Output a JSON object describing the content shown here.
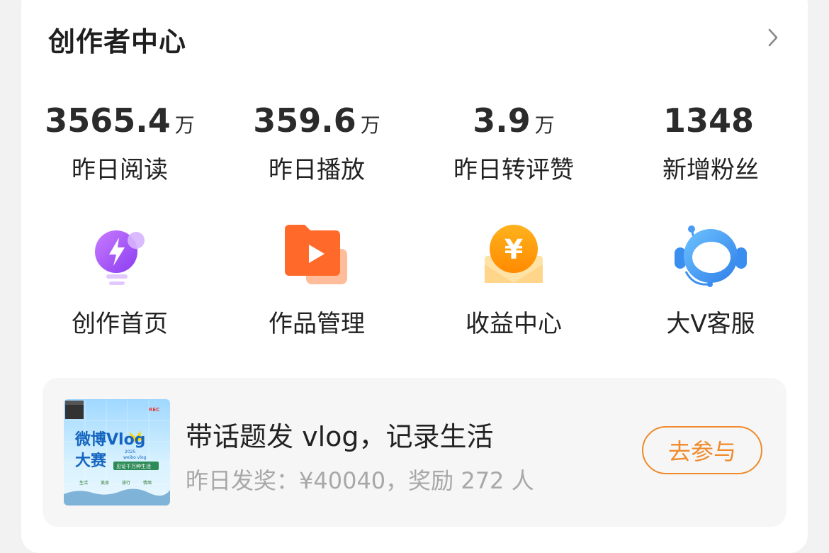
{
  "header": {
    "title": "创作者中心"
  },
  "stats": [
    {
      "value": "3565.4",
      "unit": "万",
      "label": "昨日阅读"
    },
    {
      "value": "359.6",
      "unit": "万",
      "label": "昨日播放"
    },
    {
      "value": "3.9",
      "unit": "万",
      "label": "昨日转评赞"
    },
    {
      "value": "1348",
      "unit": "",
      "label": "新增粉丝"
    }
  ],
  "tools": [
    {
      "label": "创作首页",
      "icon": "lightbulb-bolt-icon"
    },
    {
      "label": "作品管理",
      "icon": "video-folder-icon"
    },
    {
      "label": "收益中心",
      "icon": "coin-envelope-icon"
    },
    {
      "label": "大V客服",
      "icon": "headset-astronaut-icon"
    }
  ],
  "banner": {
    "thumbnail": {
      "line1": "微博Vlog",
      "line2": "大赛",
      "year": "2025",
      "sub": "weibo vlog",
      "slogan": "见证千万种生活",
      "rec": "REC",
      "tags": [
        "生活",
        "美食",
        "旅行",
        "情绪"
      ]
    },
    "title": "带话题发 vlog，记录生活",
    "subtitle": "昨日发奖：¥40040，奖励 272 人",
    "button_label": "去参与"
  },
  "colors": {
    "accent": "#f08a2a",
    "card": "#ffffff",
    "banner": "#f6f6f6"
  }
}
